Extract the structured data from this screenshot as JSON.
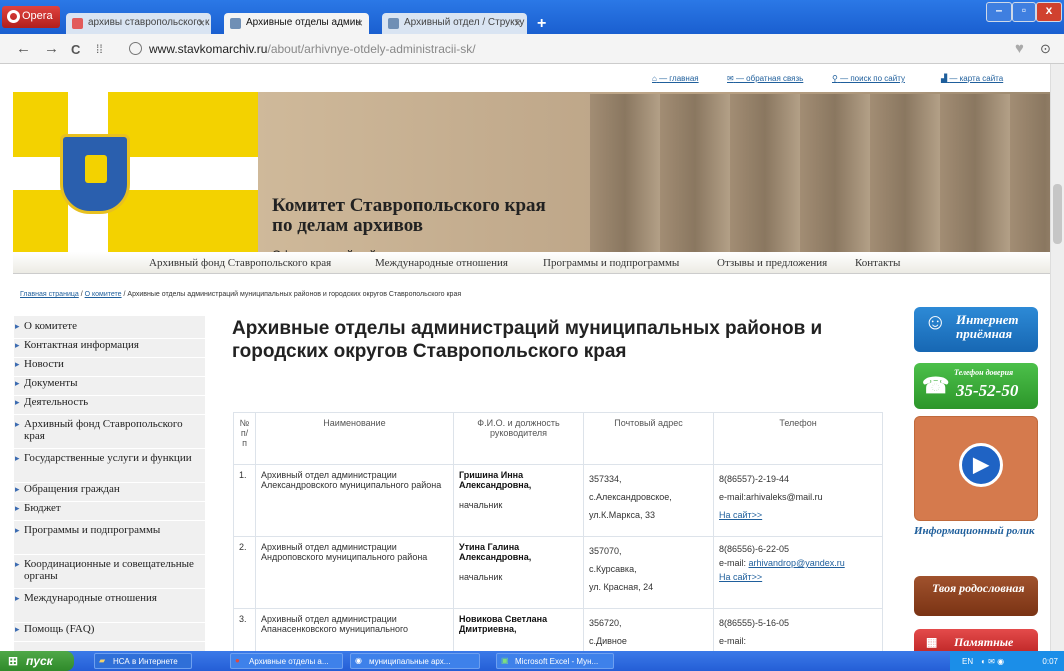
{
  "browser": {
    "menu_label": "Opera",
    "tabs": [
      {
        "label": "архивы ставропольского к"
      },
      {
        "label": "Архивные отделы админ"
      },
      {
        "label": "Архивный отдел / Структу"
      }
    ],
    "address_host": "www.stavkomarchiv.ru",
    "address_path": "/about/arhivnye-otdely-administracii-sk/"
  },
  "toplinks": [
    "— главная",
    "— обратная связь",
    "— поиск по сайту",
    "— карта сайта"
  ],
  "banner": {
    "title_line1": "Комитет Ставропольского края",
    "title_line2": "по делам архивов",
    "subtitle": "Официальный сайт"
  },
  "menu": [
    "Архивный фонд Ставропольского края",
    "Международные отношения",
    "Программы и подпрограммы",
    "Отзывы и предложения",
    "Контакты"
  ],
  "breadcrumb": {
    "home": "Главная страница",
    "sep1": " / ",
    "section": "О комитете",
    "current": " / Архивные отделы администраций муниципальных районов и городских округов Ставропольского края"
  },
  "sidebar": [
    "О комитете",
    "Контактная информация",
    "Новости",
    "Документы",
    "Деятельность",
    "Архивный фонд Ставропольского края",
    "Государственные услуги и функции",
    "Обращения граждан",
    "Бюджет",
    "Программы и подпрограммы",
    "Координационные и совещательные органы",
    "Международные отношения",
    "Помощь (FAQ)"
  ],
  "page_title": "Архивные отделы администраций муниципальных районов и городских округов Ставропольского края",
  "table": {
    "headers": [
      "№ п/п",
      "Наименование",
      "Ф.И.О. и должность руководителя",
      "Почтовый адрес",
      "Телефон"
    ],
    "rows": [
      {
        "num": "1.",
        "name": "Архивный отдел администрации Александровского муниципального района",
        "head_name": "Гришина Инна Александровна,",
        "head_post": "начальник",
        "addr1": "357334,",
        "addr2": "с.Александровское,",
        "addr3": "ул.К.Маркса, 33",
        "phone": "8(86557)-2-19-44",
        "email": "e-mail:arhivaleks@mail.ru",
        "site": "На сайт>>"
      },
      {
        "num": "2.",
        "name": "Архивный отдел администрации Андроповского муниципального района",
        "head_name": "Утина Галина Александровна,",
        "head_post": "начальник",
        "addr1": "357070,",
        "addr2": "с.Курсавка,",
        "addr3": "ул. Красная, 24",
        "phone": "8(86556)-6-22-05",
        "email_label": "e-mail:",
        "email": "arhivandrop@yandex.ru",
        "site": "На сайт>>"
      },
      {
        "num": "3.",
        "name": "Архивный отдел администрации Апанасенковского муниципального",
        "head_name": "Новикова Светлана Дмитриевна,",
        "addr1": "356720,",
        "addr2": "с.Дивное",
        "phone": "8(86555)-5-16-05",
        "email": "e-mail:"
      }
    ]
  },
  "right_banners": {
    "reception": "Интернет приёмная",
    "hotline_label": "Телефон доверия",
    "hotline_number": "35-52-50",
    "video": "Информационный ролик",
    "genealogy": "Твоя родословная",
    "dates": "Памятные"
  },
  "taskbar": {
    "start": "пуск",
    "items": [
      "НСА в Интернете",
      "Архивные отделы а...",
      "муниципальные арх...",
      "Microsoft Excel - Мун..."
    ],
    "lang": "EN",
    "time": "0:07"
  },
  "colors": {
    "titlebar": "#1f67db",
    "flag_yellow": "#f3d200",
    "link": "#1f5f9c"
  }
}
